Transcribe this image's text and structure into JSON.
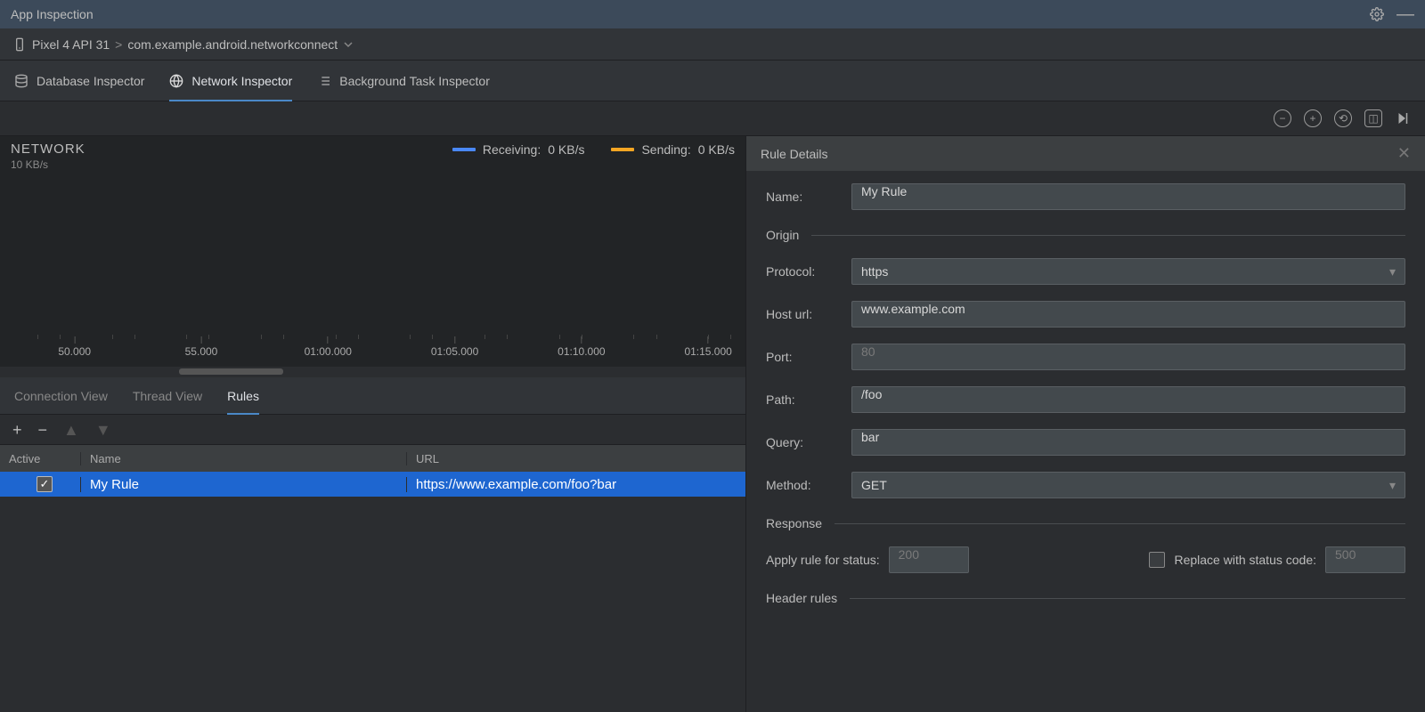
{
  "titlebar": {
    "title": "App Inspection"
  },
  "breadcrumb": {
    "device": "Pixel 4 API 31",
    "separator": ">",
    "app": "com.example.android.networkconnect"
  },
  "tabs": {
    "database": "Database Inspector",
    "network": "Network Inspector",
    "background": "Background Task Inspector",
    "active": "network"
  },
  "network": {
    "title": "NETWORK",
    "y_label": "10 KB/s",
    "receiving_label": "Receiving:",
    "receiving_value": "0 KB/s",
    "sending_label": "Sending:",
    "sending_value": "0 KB/s",
    "ticks": [
      "50.000",
      "55.000",
      "01:00.000",
      "01:05.000",
      "01:10.000",
      "01:15.000"
    ]
  },
  "subtabs": {
    "connection": "Connection View",
    "thread": "Thread View",
    "rules": "Rules",
    "active": "rules"
  },
  "rules_table": {
    "headers": {
      "active": "Active",
      "name": "Name",
      "url": "URL"
    },
    "rows": [
      {
        "active": true,
        "name": "My Rule",
        "url": "https://www.example.com/foo?bar"
      }
    ]
  },
  "detail": {
    "panel_title": "Rule Details",
    "name_label": "Name:",
    "name_value": "My Rule",
    "origin_section": "Origin",
    "protocol_label": "Protocol:",
    "protocol_value": "https",
    "host_label": "Host url:",
    "host_value": "www.example.com",
    "port_label": "Port:",
    "port_placeholder": "80",
    "path_label": "Path:",
    "path_value": "/foo",
    "query_label": "Query:",
    "query_value": "bar",
    "method_label": "Method:",
    "method_value": "GET",
    "response_section": "Response",
    "apply_status_label": "Apply rule for status:",
    "apply_status_placeholder": "200",
    "replace_label": "Replace with status code:",
    "replace_placeholder": "500",
    "header_rules_section": "Header rules"
  }
}
